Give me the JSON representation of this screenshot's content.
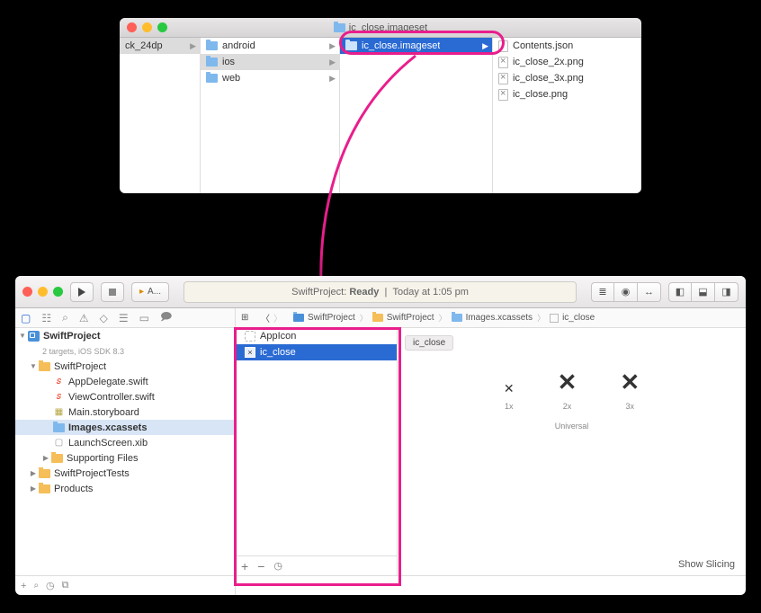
{
  "finder": {
    "title": "ic_close.imageset",
    "col0": {
      "item": "ck_24dp"
    },
    "col1": {
      "items": [
        {
          "label": "android"
        },
        {
          "label": "ios"
        },
        {
          "label": "web"
        }
      ]
    },
    "col2": {
      "item": "ic_close.imageset"
    },
    "col3": {
      "items": [
        {
          "label": "Contents.json"
        },
        {
          "label": "ic_close_2x.png"
        },
        {
          "label": "ic_close_3x.png"
        },
        {
          "label": "ic_close.png"
        }
      ]
    }
  },
  "xcode": {
    "status_project": "SwiftProject:",
    "status_state": "Ready",
    "status_sep": "|",
    "status_time": "Today at 1:05 pm",
    "scheme": "A...",
    "breadcrumb": {
      "items": [
        "SwiftProject",
        "SwiftProject",
        "Images.xcassets",
        "ic_close"
      ]
    },
    "project": {
      "name": "SwiftProject",
      "subtitle": "2 targets, iOS SDK 8.3",
      "group": "SwiftProject",
      "files": {
        "appdelegate": "AppDelegate.swift",
        "viewcontroller": "ViewController.swift",
        "storyboard": "Main.storyboard",
        "assets": "Images.xcassets",
        "launch": "LaunchScreen.xib",
        "supporting": "Supporting Files"
      },
      "tests": "SwiftProjectTests",
      "products": "Products"
    },
    "assets": {
      "items": [
        {
          "label": "AppIcon"
        },
        {
          "label": "ic_close"
        }
      ],
      "selected": "ic_close",
      "scales": {
        "x1": "1x",
        "x2": "2x",
        "x3": "3x"
      },
      "universal": "Universal",
      "slicing": "Show Slicing"
    }
  }
}
